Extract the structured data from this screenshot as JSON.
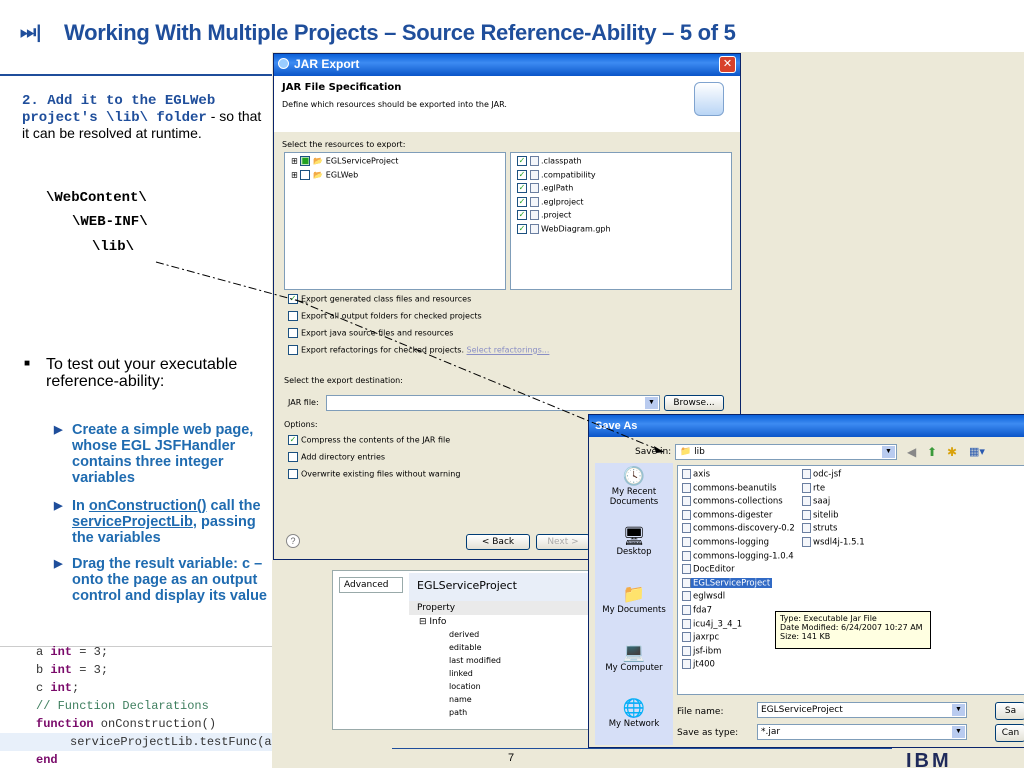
{
  "header": {
    "icon": "⏭|",
    "title": "Working With Multiple Projects – Source Reference-Ability – 5 of 5"
  },
  "left": {
    "step2_bold": "2. Add it to the EGLWeb project's \\lib\\ folder",
    "step2_rest": " - so that it can be resolved at runtime.",
    "path1": "\\WebContent\\",
    "path2": "\\WEB-INF\\",
    "path3": "\\lib\\",
    "bullet": "To test out your executable reference-ability:",
    "sub1": "Create a simple web page, whose EGL JSFHandler contains three integer variables",
    "sub2_a": "In ",
    "sub2_link1": "onConstruction()",
    "sub2_b": " call the ",
    "sub2_link2": "serviceProjectLib",
    "sub2_c": ", passing the variables",
    "sub3": "Drag the result variable: c – onto the page as an output control and display its value"
  },
  "code": {
    "l1a": "a ",
    "l1k": "int",
    "l1b": " = 3;",
    "l2a": "b ",
    "l2k": "int",
    "l2b": " = 3;",
    "l3a": "c ",
    "l3k": "int",
    "l3b": ";",
    "l4": "// Function Declarations",
    "l5k": "function",
    "l5b": " onConstruction()",
    "l6": "serviceProjectLib.testFunc(a, b, c);",
    "l7": "end"
  },
  "jar": {
    "title": "JAR Export",
    "heading": "JAR File Specification",
    "subheading": "Define which resources should be exported into the JAR.",
    "select_label": "Select the resources to export:",
    "tree": [
      "EGLServiceProject",
      "EGLWeb"
    ],
    "files": [
      ".classpath",
      ".compatibility",
      ".eglPath",
      ".eglproject",
      ".project",
      "WebDiagram.gph"
    ],
    "opt1": "Export generated class files and resources",
    "opt2": "Export all output folders for checked projects",
    "opt3": "Export java source files and resources",
    "opt4": "Export refactorings for checked projects.",
    "opt4_link": "Select refactorings...",
    "dest_label": "Select the export destination:",
    "jar_file_label": "JAR file:",
    "browse": "Browse...",
    "options_label": "Options:",
    "o1": "Compress the contents of the JAR file",
    "o2": "Add directory entries",
    "o3": "Overwrite existing files without warning",
    "back": "< Back",
    "next": "Next >"
  },
  "props": {
    "tab": "Advanced",
    "title": "EGLServiceProject",
    "col": "Property",
    "group": "Info",
    "rows": [
      "derived",
      "editable",
      "last modified",
      "linked",
      "location",
      "name",
      "path"
    ]
  },
  "saveas": {
    "title": "Save As",
    "save_in_label": "Save in:",
    "save_in_value": "lib",
    "places": [
      "My Recent Documents",
      "Desktop",
      "My Documents",
      "My Computer",
      "My Network"
    ],
    "col1": [
      "axis",
      "commons-beanutils",
      "commons-collections",
      "commons-digester",
      "commons-discovery-0.2",
      "commons-logging",
      "commons-logging-1.0.4",
      "DocEditor",
      "EGLServiceProject",
      "eglwsdl",
      "fda7",
      "icu4j_3_4_1",
      "jaxrpc",
      "jsf-ibm",
      "jt400"
    ],
    "col2": [
      "odc-jsf",
      "rte",
      "saaj",
      "sitelib",
      "struts",
      "wsdl4j-1.5.1"
    ],
    "tip1": "Type: Executable Jar File",
    "tip2": "Date Modified: 6/24/2007 10:27 AM",
    "tip3": "Size: 141 KB",
    "fname_label": "File name:",
    "fname_value": "EGLServiceProject",
    "ftype_label": "Save as type:",
    "ftype_value": "*.jar",
    "save_btn": "Sa",
    "cancel_btn": "Can"
  },
  "footer": {
    "page": "7",
    "logo": "IBM"
  }
}
